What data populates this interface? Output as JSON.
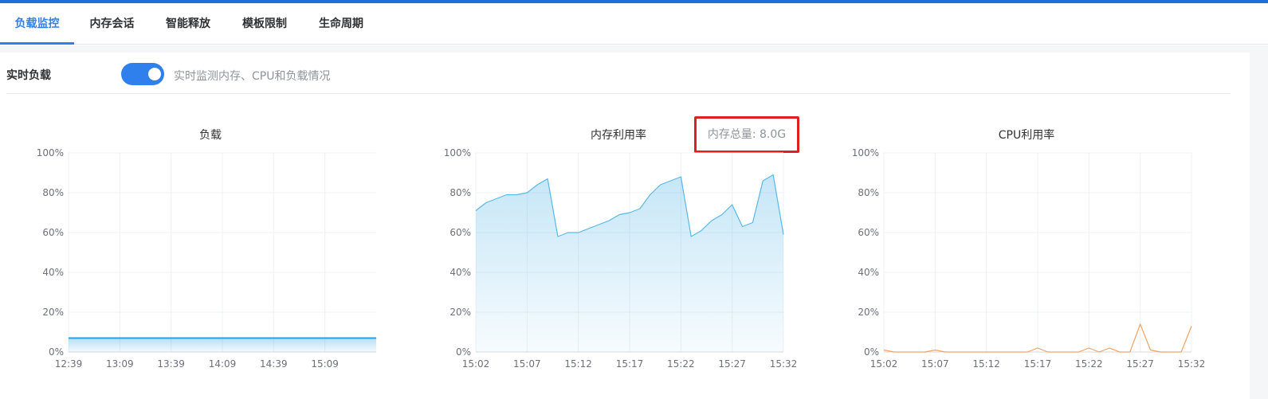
{
  "tabs": [
    {
      "label": "负载监控",
      "active": true
    },
    {
      "label": "内存会话",
      "active": false
    },
    {
      "label": "智能释放",
      "active": false
    },
    {
      "label": "模板限制",
      "active": false
    },
    {
      "label": "生命周期",
      "active": false
    }
  ],
  "realtime": {
    "label": "实时负载",
    "toggle_on": true,
    "description": "实时监测内存、CPU和负载情况"
  },
  "memory_total_label": "内存总量: 8.0G",
  "colors": {
    "accent": "#2f80ed",
    "load_line": "#29a3e0",
    "memory_line": "#5ab8e8",
    "cpu_line": "#f4a261",
    "highlight_box": "#e02020"
  },
  "chart_data": [
    {
      "type": "area",
      "title": "负载",
      "x": [
        "12:39",
        "13:09",
        "13:39",
        "14:09",
        "14:39",
        "15:09",
        "15:39"
      ],
      "x_ticks": [
        "12:39",
        "13:09",
        "13:39",
        "14:09",
        "14:39",
        "15:09"
      ],
      "series": [
        {
          "values": [
            7,
            7,
            7,
            7,
            7,
            7,
            7
          ]
        }
      ],
      "y_ticks": [
        "0%",
        "20%",
        "40%",
        "60%",
        "80%",
        "100%"
      ],
      "ylim": [
        0,
        100
      ],
      "grid": true
    },
    {
      "type": "area",
      "title": "内存利用率",
      "x": [
        "15:02",
        "15:03",
        "15:04",
        "15:05",
        "15:06",
        "15:07",
        "15:08",
        "15:09",
        "15:10",
        "15:11",
        "15:12",
        "15:13",
        "15:14",
        "15:15",
        "15:16",
        "15:17",
        "15:18",
        "15:19",
        "15:20",
        "15:21",
        "15:22",
        "15:23",
        "15:24",
        "15:25",
        "15:26",
        "15:27",
        "15:28",
        "15:29",
        "15:30",
        "15:31",
        "15:32"
      ],
      "x_ticks": [
        "15:02",
        "15:07",
        "15:12",
        "15:17",
        "15:22",
        "15:27",
        "15:32"
      ],
      "series": [
        {
          "values": [
            71,
            75,
            77,
            79,
            79,
            80,
            84,
            87,
            58,
            60,
            60,
            62,
            64,
            66,
            69,
            70,
            72,
            79,
            84,
            86,
            88,
            58,
            61,
            66,
            69,
            74,
            63,
            65,
            86,
            89,
            59
          ]
        }
      ],
      "y_ticks": [
        "0%",
        "20%",
        "40%",
        "60%",
        "80%",
        "100%"
      ],
      "ylim": [
        0,
        100
      ],
      "grid": true
    },
    {
      "type": "line",
      "title": "CPU利用率",
      "x": [
        "15:02",
        "15:03",
        "15:04",
        "15:05",
        "15:06",
        "15:07",
        "15:08",
        "15:09",
        "15:10",
        "15:11",
        "15:12",
        "15:13",
        "15:14",
        "15:15",
        "15:16",
        "15:17",
        "15:18",
        "15:19",
        "15:20",
        "15:21",
        "15:22",
        "15:23",
        "15:24",
        "15:25",
        "15:26",
        "15:27",
        "15:28",
        "15:29",
        "15:30",
        "15:31",
        "15:32"
      ],
      "x_ticks": [
        "15:02",
        "15:07",
        "15:12",
        "15:17",
        "15:22",
        "15:27",
        "15:32"
      ],
      "series": [
        {
          "values": [
            1,
            0,
            0,
            0,
            0,
            1,
            0,
            0,
            0,
            0,
            0,
            0,
            0,
            0,
            0,
            2,
            0,
            0,
            0,
            0,
            2,
            0,
            2,
            0,
            0,
            14,
            1,
            0,
            0,
            0,
            13
          ]
        }
      ],
      "y_ticks": [
        "0%",
        "20%",
        "40%",
        "60%",
        "80%",
        "100%"
      ],
      "ylim": [
        0,
        100
      ],
      "grid": true
    }
  ]
}
